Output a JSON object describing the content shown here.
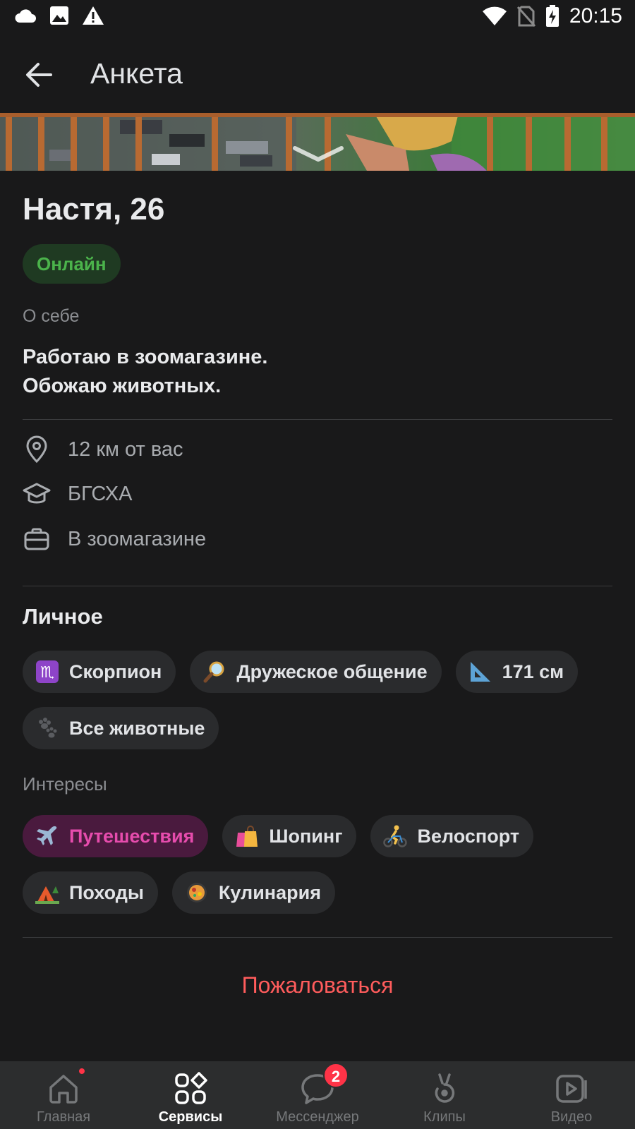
{
  "status_bar": {
    "time": "20:15",
    "left_icons": [
      "cloud-icon",
      "image-icon",
      "warning-icon"
    ],
    "right_icons": [
      "wifi-icon",
      "no-sim-icon",
      "battery-charging-icon"
    ]
  },
  "header": {
    "back_icon": "arrow-left-icon",
    "title": "Анкета"
  },
  "profile": {
    "name": "Настя, 26",
    "status": "Онлайн",
    "about_label": "О себе",
    "about_lines": [
      "Работаю в зоомагазине.",
      "Обожаю животных."
    ],
    "info": [
      {
        "icon": "location-pin-icon",
        "text": "12 км от вас"
      },
      {
        "icon": "graduation-cap-icon",
        "text": "БГСХА"
      },
      {
        "icon": "briefcase-icon",
        "text": "В зоомагазине"
      }
    ]
  },
  "personal": {
    "title": "Личное",
    "chips": [
      {
        "emoji": "♏",
        "label": "Скорпион"
      },
      {
        "emoji": "🔎",
        "label": "Дружеское общение"
      },
      {
        "emoji": "📐",
        "label": "171 см"
      },
      {
        "emoji": "🐾",
        "label": "Все животные"
      }
    ]
  },
  "interests": {
    "label": "Интересы",
    "chips": [
      {
        "emoji": "✈️",
        "label": "Путешествия",
        "active": true
      },
      {
        "emoji": "🛍️",
        "label": "Шопинг"
      },
      {
        "emoji": "🚴",
        "label": "Велоспорт"
      },
      {
        "emoji": "🏕️",
        "label": "Походы"
      },
      {
        "emoji": "🥘",
        "label": "Кулинария"
      }
    ]
  },
  "report_label": "Пожаловаться",
  "bottom_nav": {
    "items": [
      {
        "label": "Главная",
        "icon": "home-icon",
        "has_dot": true
      },
      {
        "label": "Сервисы",
        "icon": "services-grid-icon",
        "active": true
      },
      {
        "label": "Мессенджер",
        "icon": "chat-bubble-icon",
        "badge": "2"
      },
      {
        "label": "Клипы",
        "icon": "clips-icon"
      },
      {
        "label": "Видео",
        "icon": "video-play-icon"
      }
    ]
  },
  "colors": {
    "background": "#19191a",
    "online_green": "#4bb34b",
    "accent_pink": "#e64cad",
    "report_red": "#ff5c5c",
    "badge_red": "#ff3347"
  }
}
